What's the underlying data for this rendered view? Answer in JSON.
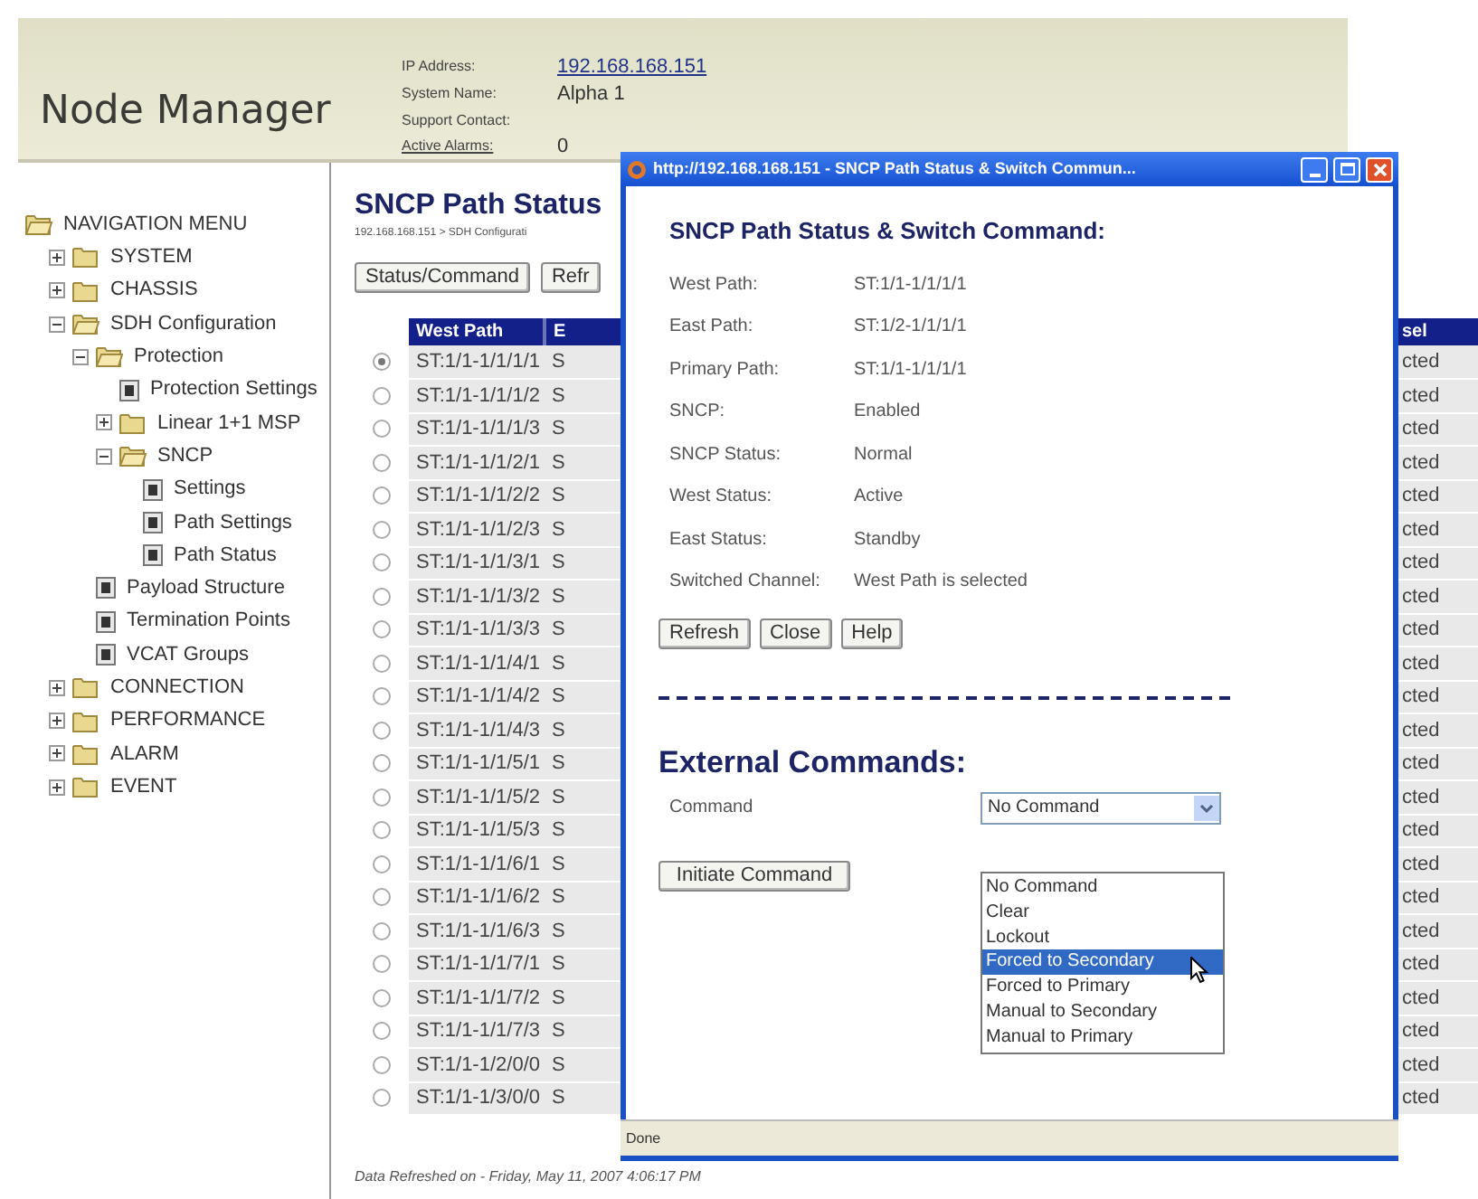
{
  "header": {
    "logo": "Node Manager",
    "fields": [
      {
        "label": "IP Address:",
        "label_link": false,
        "value": "192.168.168.151",
        "value_link": true
      },
      {
        "label": "System Name:",
        "label_link": false,
        "value": "Alpha 1",
        "value_link": false
      },
      {
        "label": "Support Contact:",
        "label_link": false
      },
      {
        "label": "Active Alarms:",
        "label_link": true,
        "value": "0",
        "value_link": false
      }
    ]
  },
  "nav": {
    "label": "NAVIGATION MENU",
    "kind": "root",
    "children": [
      {
        "label": "SYSTEM",
        "kind": "folder",
        "expanded": false
      },
      {
        "label": "CHASSIS",
        "kind": "folder",
        "expanded": false
      },
      {
        "label": "SDH Configuration",
        "kind": "folder",
        "expanded": true,
        "children": [
          {
            "label": "Protection",
            "kind": "folder",
            "expanded": true,
            "children": [
              {
                "label": "Protection Settings",
                "kind": "page"
              },
              {
                "label": "Linear 1+1 MSP",
                "kind": "folder",
                "expanded": false
              },
              {
                "label": "SNCP",
                "kind": "folder",
                "expanded": true,
                "children": [
                  {
                    "label": "Settings",
                    "kind": "page"
                  },
                  {
                    "label": "Path Settings",
                    "kind": "page"
                  },
                  {
                    "label": "Path Status",
                    "kind": "page"
                  }
                ]
              }
            ]
          },
          {
            "label": "Payload Structure",
            "kind": "page"
          },
          {
            "label": "Termination Points",
            "kind": "page"
          },
          {
            "label": "VCAT Groups",
            "kind": "page"
          }
        ]
      },
      {
        "label": "CONNECTION",
        "kind": "folder",
        "expanded": false
      },
      {
        "label": "PERFORMANCE",
        "kind": "folder",
        "expanded": false
      },
      {
        "label": "ALARM",
        "kind": "folder",
        "expanded": false
      },
      {
        "label": "EVENT",
        "kind": "folder",
        "expanded": false
      }
    ]
  },
  "main": {
    "title": "SNCP Path Status",
    "breadcrumb": "192.168.168.151 > SDH Configurati",
    "buttons": [
      "Status/Command",
      "Refr"
    ],
    "table": {
      "columns": [
        "West Path",
        "E",
        "sel"
      ],
      "rows": [
        {
          "selected": true,
          "cells": [
            "ST:1/1-1/1/1/1",
            "S",
            "cted"
          ]
        },
        {
          "selected": false,
          "cells": [
            "ST:1/1-1/1/1/2",
            "S",
            "cted"
          ]
        },
        {
          "selected": false,
          "cells": [
            "ST:1/1-1/1/1/3",
            "S",
            "cted"
          ]
        },
        {
          "selected": false,
          "cells": [
            "ST:1/1-1/1/2/1",
            "S",
            "cted"
          ]
        },
        {
          "selected": false,
          "cells": [
            "ST:1/1-1/1/2/2",
            "S",
            "cted"
          ]
        },
        {
          "selected": false,
          "cells": [
            "ST:1/1-1/1/2/3",
            "S",
            "cted"
          ]
        },
        {
          "selected": false,
          "cells": [
            "ST:1/1-1/1/3/1",
            "S",
            "cted"
          ]
        },
        {
          "selected": false,
          "cells": [
            "ST:1/1-1/1/3/2",
            "S",
            "cted"
          ]
        },
        {
          "selected": false,
          "cells": [
            "ST:1/1-1/1/3/3",
            "S",
            "cted"
          ]
        },
        {
          "selected": false,
          "cells": [
            "ST:1/1-1/1/4/1",
            "S",
            "cted"
          ]
        },
        {
          "selected": false,
          "cells": [
            "ST:1/1-1/1/4/2",
            "S",
            "cted"
          ]
        },
        {
          "selected": false,
          "cells": [
            "ST:1/1-1/1/4/3",
            "S",
            "cted"
          ]
        },
        {
          "selected": false,
          "cells": [
            "ST:1/1-1/1/5/1",
            "S",
            "cted"
          ]
        },
        {
          "selected": false,
          "cells": [
            "ST:1/1-1/1/5/2",
            "S",
            "cted"
          ]
        },
        {
          "selected": false,
          "cells": [
            "ST:1/1-1/1/5/3",
            "S",
            "cted"
          ]
        },
        {
          "selected": false,
          "cells": [
            "ST:1/1-1/1/6/1",
            "S",
            "cted"
          ]
        },
        {
          "selected": false,
          "cells": [
            "ST:1/1-1/1/6/2",
            "S",
            "cted"
          ]
        },
        {
          "selected": false,
          "cells": [
            "ST:1/1-1/1/6/3",
            "S",
            "cted"
          ]
        },
        {
          "selected": false,
          "cells": [
            "ST:1/1-1/1/7/1",
            "S",
            "cted"
          ]
        },
        {
          "selected": false,
          "cells": [
            "ST:1/1-1/1/7/2",
            "S",
            "cted"
          ]
        },
        {
          "selected": false,
          "cells": [
            "ST:1/1-1/1/7/3",
            "S",
            "cted"
          ]
        },
        {
          "selected": false,
          "cells": [
            "ST:1/1-1/2/0/0",
            "S",
            "cted"
          ]
        },
        {
          "selected": false,
          "cells": [
            "ST:1/1-1/3/0/0",
            "S",
            "cted"
          ]
        }
      ]
    },
    "footer": "Data Refreshed on - Friday, May 11, 2007 4:06:17 PM"
  },
  "popup": {
    "title": "http://192.168.168.151 - SNCP Path Status & Switch Commun...",
    "heading": "SNCP Path Status & Switch Command:",
    "fields": [
      {
        "label": "West Path:",
        "value": "ST:1/1-1/1/1/1"
      },
      {
        "label": "East Path:",
        "value": "ST:1/2-1/1/1/1"
      },
      {
        "label": "Primary Path:",
        "value": "ST:1/1-1/1/1/1"
      },
      {
        "label": "SNCP:",
        "value": "Enabled"
      },
      {
        "label": "SNCP Status:",
        "value": "Normal"
      },
      {
        "label": "West Status:",
        "value": "Active"
      },
      {
        "label": "East Status:",
        "value": "Standby"
      },
      {
        "label": "Switched Channel:",
        "value": "West Path is selected"
      }
    ],
    "buttons": [
      "Refresh",
      "Close",
      "Help"
    ],
    "external_heading": "External Commands:",
    "command_label": "Command",
    "select_value": "No Command",
    "options": [
      {
        "label": "No Command",
        "selected": false
      },
      {
        "label": "Clear",
        "selected": false
      },
      {
        "label": "Lockout",
        "selected": false
      },
      {
        "label": "Forced to Secondary",
        "selected": true
      },
      {
        "label": "Forced to Primary",
        "selected": false
      },
      {
        "label": "Manual to Secondary",
        "selected": false
      },
      {
        "label": "Manual to Primary",
        "selected": false
      }
    ],
    "initiate_button": "Initiate Command",
    "status": "Done"
  }
}
